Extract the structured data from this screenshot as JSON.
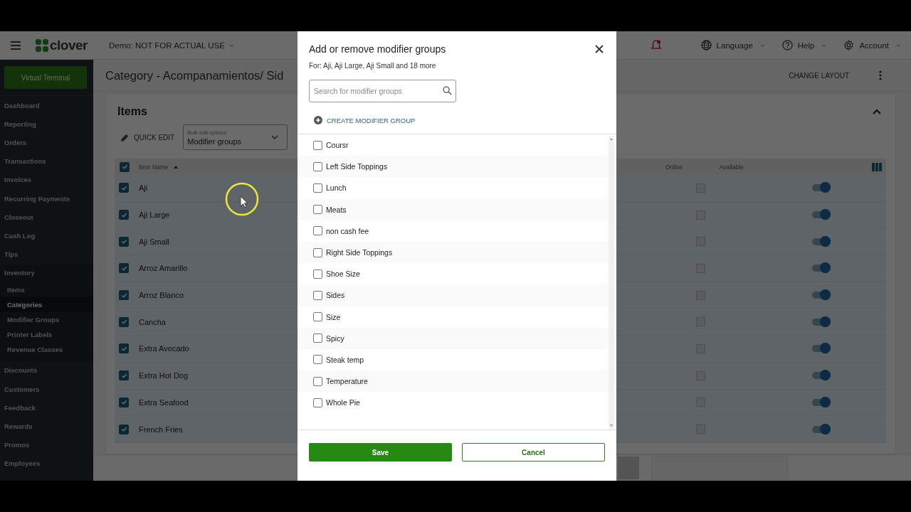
{
  "top_bar": {
    "brand": "clover",
    "merchant": "Demo: NOT FOR ACTUAL USE",
    "menus": [
      {
        "label": "Language",
        "kind": "globe"
      },
      {
        "label": "Help",
        "kind": "help"
      },
      {
        "label": "Account",
        "kind": "gear"
      }
    ]
  },
  "sidebar": {
    "primary_button": "Virtual Terminal",
    "items": [
      {
        "label": "Dashboard",
        "selected": false
      },
      {
        "label": "Reporting",
        "selected": false
      },
      {
        "label": "Orders",
        "selected": false
      },
      {
        "label": "Transactions",
        "selected": false
      },
      {
        "label": "Invoices",
        "selected": false
      },
      {
        "label": "Recurring Payments",
        "selected": false
      },
      {
        "label": "Closeout",
        "selected": false
      },
      {
        "label": "Cash Log",
        "selected": false
      },
      {
        "label": "Tips",
        "selected": false
      },
      {
        "label": "Inventory",
        "selected": false,
        "children": [
          {
            "label": "Items",
            "selected": false
          },
          {
            "label": "Categories",
            "selected": true
          },
          {
            "label": "Modifier Groups",
            "selected": false
          },
          {
            "label": "Printer Labels",
            "selected": false
          },
          {
            "label": "Revenue Classes",
            "selected": false
          }
        ]
      },
      {
        "label": "Discounts",
        "selected": false
      },
      {
        "label": "Customers",
        "selected": false
      },
      {
        "label": "Feedback",
        "selected": false
      },
      {
        "label": "Rewards",
        "selected": false
      },
      {
        "label": "Promos",
        "selected": false
      },
      {
        "label": "Employees",
        "selected": false
      }
    ]
  },
  "page": {
    "title": "Category - Acompanamientos/ Sid",
    "change_layout": "CHANGE LAYOUT"
  },
  "items_card": {
    "title": "Items",
    "quick_edit": "QUICK EDIT",
    "bulk_edit": {
      "label": "Bulk edit options",
      "value": "Modifier groups"
    },
    "columns": [
      "Item Name",
      "Online",
      "Available"
    ],
    "all_checked": true,
    "rows": [
      {
        "name": "Aji",
        "checked": true,
        "online": false,
        "available": true
      },
      {
        "name": "Aji Large",
        "checked": true,
        "online": false,
        "available": true
      },
      {
        "name": "Aji Small",
        "checked": true,
        "online": false,
        "available": true
      },
      {
        "name": "Arroz Amarillo",
        "checked": true,
        "online": false,
        "available": true
      },
      {
        "name": "Arroz Blanco",
        "checked": true,
        "online": false,
        "available": true
      },
      {
        "name": "Cancha",
        "checked": true,
        "online": false,
        "available": true
      },
      {
        "name": "Extra Avocado",
        "checked": true,
        "online": false,
        "available": true
      },
      {
        "name": "Extra Hot Dog",
        "checked": true,
        "online": false,
        "available": true
      },
      {
        "name": "Extra Seafood",
        "checked": true,
        "online": false,
        "available": true
      },
      {
        "name": "French Fries",
        "checked": true,
        "online": false,
        "available": true
      }
    ]
  },
  "modal": {
    "title": "Add or remove modifier groups",
    "subtitle": "For: Aji, Aji Large, Aji Small and 18 more",
    "search": {
      "placeholder": "Search for modifier groups"
    },
    "create_link": "CREATE MODIFIER GROUP",
    "options": [
      {
        "label": "Coursr",
        "checked": false
      },
      {
        "label": "Left Side Toppings",
        "checked": false
      },
      {
        "label": "Lunch",
        "checked": false
      },
      {
        "label": "Meats",
        "checked": false
      },
      {
        "label": "non cash fee",
        "checked": false
      },
      {
        "label": "Right Side Toppings",
        "checked": false
      },
      {
        "label": "Shoe Size",
        "checked": false
      },
      {
        "label": "Sides",
        "checked": false
      },
      {
        "label": "Size",
        "checked": false
      },
      {
        "label": "Spicy",
        "checked": false
      },
      {
        "label": "Steak temp",
        "checked": false
      },
      {
        "label": "Temperature",
        "checked": false
      },
      {
        "label": "Whole Pie",
        "checked": false
      }
    ],
    "save": "Save",
    "cancel": "Cancel"
  }
}
